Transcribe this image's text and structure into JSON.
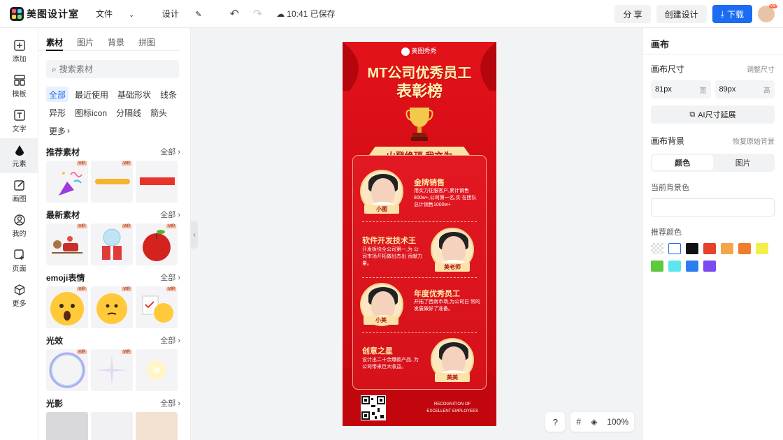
{
  "header": {
    "app_name": "美图设计室",
    "menu_file": "文件",
    "menu_design": "设计",
    "save_status": "10:41 已保存",
    "share": "分 享",
    "create_design": "创建设计",
    "download": "下载",
    "vip_badge": "VIP"
  },
  "leftbar": {
    "items": [
      {
        "label": "添加"
      },
      {
        "label": "模板"
      },
      {
        "label": "文字"
      },
      {
        "label": "元素"
      },
      {
        "label": "画图"
      },
      {
        "label": "我的"
      },
      {
        "label": "页面"
      },
      {
        "label": "更多"
      }
    ]
  },
  "panel": {
    "tabs": [
      "素材",
      "图片",
      "背景",
      "拼图"
    ],
    "search_placeholder": "搜索素材",
    "chips": [
      "全部",
      "最近使用",
      "基础形状",
      "线条",
      "异形",
      "图标icon",
      "分隔线",
      "箭头",
      "更多"
    ],
    "all_label": "全部",
    "vip_label": "VIP",
    "sections": [
      {
        "title": "推荐素材"
      },
      {
        "title": "最新素材"
      },
      {
        "title": "emoji表情"
      },
      {
        "title": "光效"
      },
      {
        "title": "光影"
      }
    ]
  },
  "poster": {
    "logo_text": "美图秀秀",
    "title_line1": "MT公司优秀员工",
    "title_line2": "表彰榜",
    "banner": "山登绝顶 我亦为",
    "entries": [
      {
        "title": "金牌销售",
        "name": "小图",
        "desc": "用实力征服客户,累计销售 800w+,公司第一名,实 在团队总计销售1000w+"
      },
      {
        "title": "软件开发技术王",
        "name": "美老师",
        "desc": "开发板块全公司第一,为 公司市场开拓做出杰出 贡献力量。"
      },
      {
        "title": "年度优秀员工",
        "name": "小美",
        "desc": "开拓了西南市场,为公司日 常的发展做好了准备。"
      },
      {
        "title": "创意之星",
        "name": "美美",
        "desc": "设计出二十余爆款产品, 为公司带来巨大收益。"
      }
    ],
    "footer_line1": "RECOGNITION OF",
    "footer_line2": "EXCELLENT EMPLOYEES"
  },
  "canvas_tools": {
    "help": "?",
    "zoom": "100%"
  },
  "rightpanel": {
    "title": "画布",
    "size_label": "画布尺寸",
    "adjust_size": "调整尺寸",
    "width_value": "81px",
    "width_unit": "宽",
    "height_value": "89px",
    "height_unit": "高",
    "ai_extend": "AI尺寸延展",
    "bg_label": "画布背景",
    "restore_bg": "恢复原始背景",
    "seg_color": "颜色",
    "seg_image": "图片",
    "current_bg": "当前背景色",
    "recommend": "推荐颜色",
    "swatches": [
      "transparent",
      "#ffffff",
      "#111111",
      "#e8412b",
      "#f2a54a",
      "#ef7d2c",
      "#f3ee4a",
      "#5cc93f",
      "#5ee6ef",
      "#2c7ef0",
      "#7a4bf0"
    ]
  }
}
